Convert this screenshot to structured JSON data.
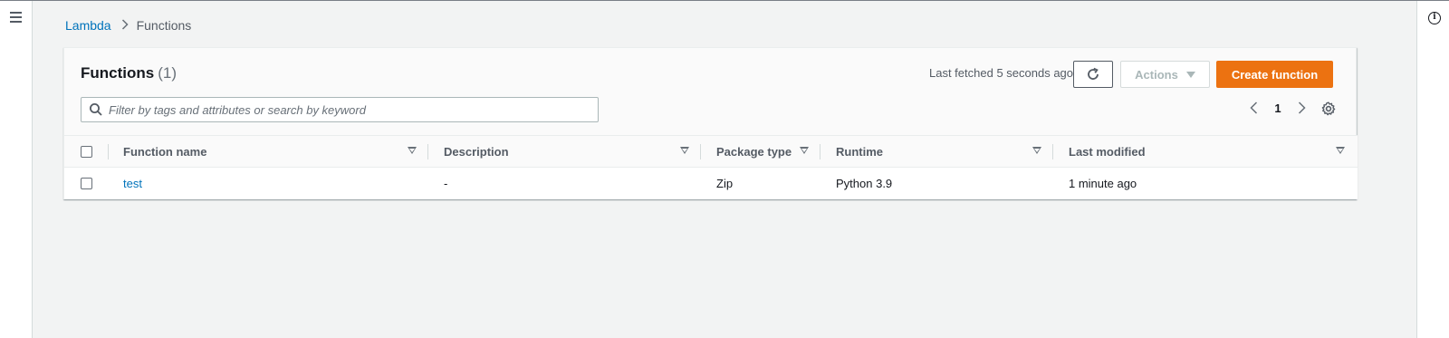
{
  "breadcrumb": {
    "root": "Lambda",
    "separator": ">",
    "current": "Functions"
  },
  "panel": {
    "title": "Functions",
    "count": "(1)",
    "last_fetched": "Last fetched 5 seconds ago",
    "actions_label": "Actions",
    "create_label": "Create function",
    "search_placeholder": "Filter by tags and attributes or search by keyword",
    "page": "1"
  },
  "table": {
    "columns": [
      "Function name",
      "Description",
      "Package type",
      "Runtime",
      "Last modified"
    ],
    "rows": [
      {
        "name": "test",
        "description": "-",
        "package_type": "Zip",
        "runtime": "Python 3.9",
        "last_modified": "1 minute ago"
      }
    ]
  },
  "colors": {
    "link": "#0073bb",
    "primary": "#ec7211",
    "background": "#f2f3f3"
  },
  "icons": [
    "menu-icon",
    "info-icon",
    "refresh-icon",
    "caret-down-icon",
    "search-icon",
    "chevron-left-icon",
    "chevron-right-icon",
    "gear-icon",
    "sort-caret-icon"
  ]
}
